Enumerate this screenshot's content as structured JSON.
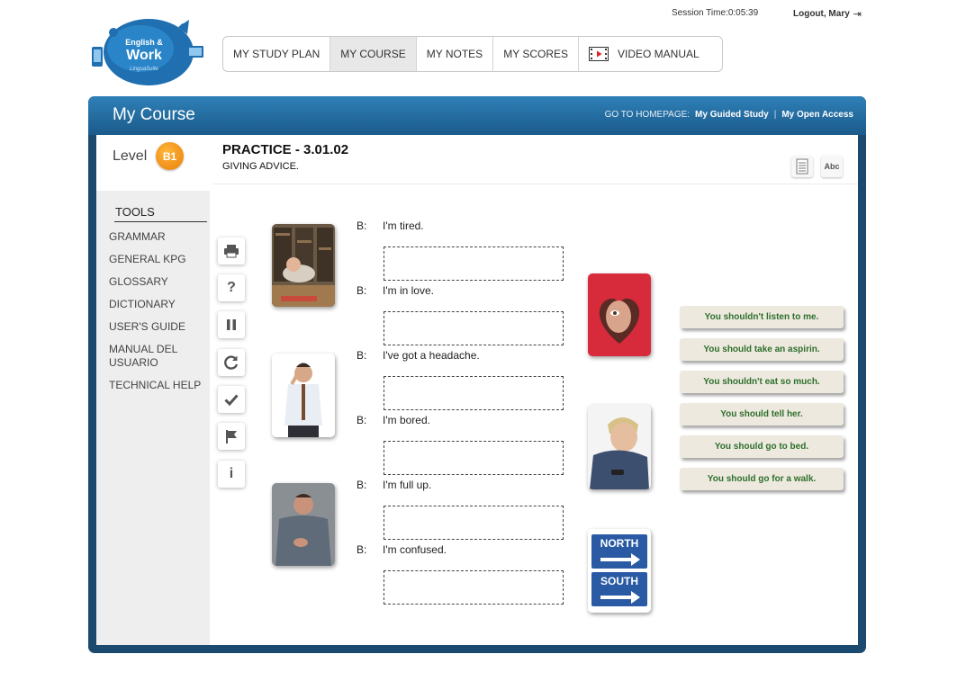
{
  "header": {
    "session_label": "Session Time:",
    "session_time": "0:05:39",
    "logout_label": "Logout, Mary",
    "logo": {
      "line1": "English &",
      "line2": "Work",
      "sub": "LinguaSuite"
    }
  },
  "nav": {
    "items": [
      "MY STUDY PLAN",
      "MY COURSE",
      "MY NOTES",
      "MY SCORES"
    ],
    "video_label": "VIDEO MANUAL",
    "active": "MY COURSE"
  },
  "panel": {
    "title": "My Course",
    "goto_label": "GO TO HOMEPAGE:",
    "link_guided": "My Guided Study",
    "separator": "|",
    "link_open": "My Open Access"
  },
  "sidebar": {
    "level_label": "Level",
    "level_badge": "B1",
    "tools_title": "TOOLS",
    "tools": [
      "GRAMMAR",
      "GENERAL KPG",
      "GLOSSARY",
      "DICTIONARY",
      "USER'S GUIDE",
      "MANUAL DEL USUARIO",
      "TECHNICAL HELP"
    ]
  },
  "exercise": {
    "title": "PRACTICE - 3.01.02",
    "subtitle": "GIVING ADVICE.",
    "abc_icon": "Abc",
    "speaker": "B:",
    "sentences": [
      "I'm tired.",
      "I'm in love.",
      "I've got a headache.",
      "I'm bored.",
      "I'm full up.",
      "I'm confused."
    ],
    "answers": [
      "You shouldn't listen to me.",
      "You should take an aspirin.",
      "You shouldn't eat so much.",
      "You should tell her.",
      "You should go to bed.",
      "You should go for a walk."
    ],
    "sign_top": "NORTH",
    "sign_bottom": "SOUTH"
  },
  "colors": {
    "header_blue": "#2e80b8",
    "panel_dark": "#1c4a6e",
    "level_orange": "#f39a1f",
    "answer_green": "#2d6f2d",
    "answer_bg": "#eee9de"
  },
  "icons": {
    "toolbar": [
      "print-icon",
      "help-icon",
      "pause-icon",
      "reset-icon",
      "check-icon",
      "flag-icon",
      "info-icon"
    ],
    "header": [
      "notes-icon",
      "abc-icon",
      "logout-icon",
      "video-film-icon"
    ]
  }
}
